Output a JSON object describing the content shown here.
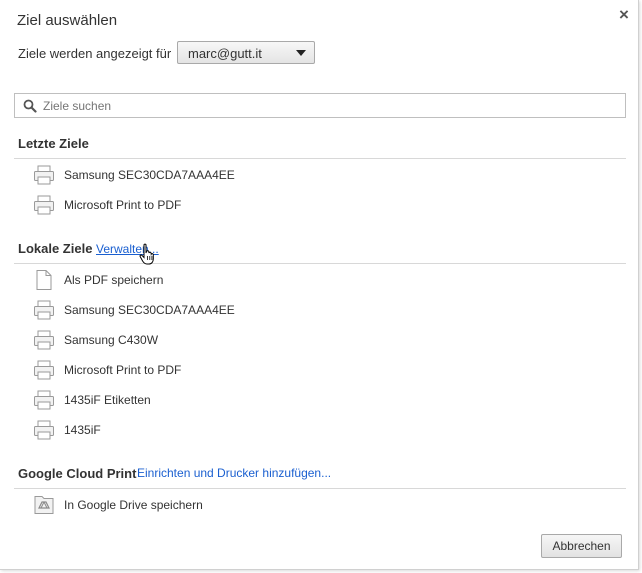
{
  "dialog": {
    "title": "Ziel auswählen",
    "close_label": "×"
  },
  "account": {
    "label": "Ziele werden angezeigt für",
    "selected": "marc@gutt.it"
  },
  "search": {
    "placeholder": "Ziele suchen"
  },
  "recent": {
    "heading": "Letzte Ziele",
    "items": [
      {
        "label": "Samsung SEC30CDA7AAA4EE",
        "icon": "printer-icon"
      },
      {
        "label": "Microsoft Print to PDF",
        "icon": "printer-icon"
      }
    ]
  },
  "local": {
    "heading": "Lokale Ziele",
    "manage_link": "Verwalten...",
    "items": [
      {
        "label": "Als PDF speichern",
        "icon": "pdf-file-icon"
      },
      {
        "label": "Samsung SEC30CDA7AAA4EE",
        "icon": "printer-icon"
      },
      {
        "label": "Samsung C430W",
        "icon": "printer-icon"
      },
      {
        "label": "Microsoft Print to PDF",
        "icon": "printer-icon"
      },
      {
        "label": "1435iF Etiketten",
        "icon": "printer-icon"
      },
      {
        "label": "1435iF",
        "icon": "printer-icon"
      }
    ]
  },
  "cloud": {
    "heading": "Google Cloud Print",
    "setup_link": "Einrichten und Drucker hinzufügen...",
    "items": [
      {
        "label": "In Google Drive speichern",
        "icon": "google-drive-icon"
      }
    ]
  },
  "footer": {
    "cancel_label": "Abbrechen"
  },
  "colors": {
    "link": "#1a5fd0",
    "rule": "#d8d8d8"
  }
}
